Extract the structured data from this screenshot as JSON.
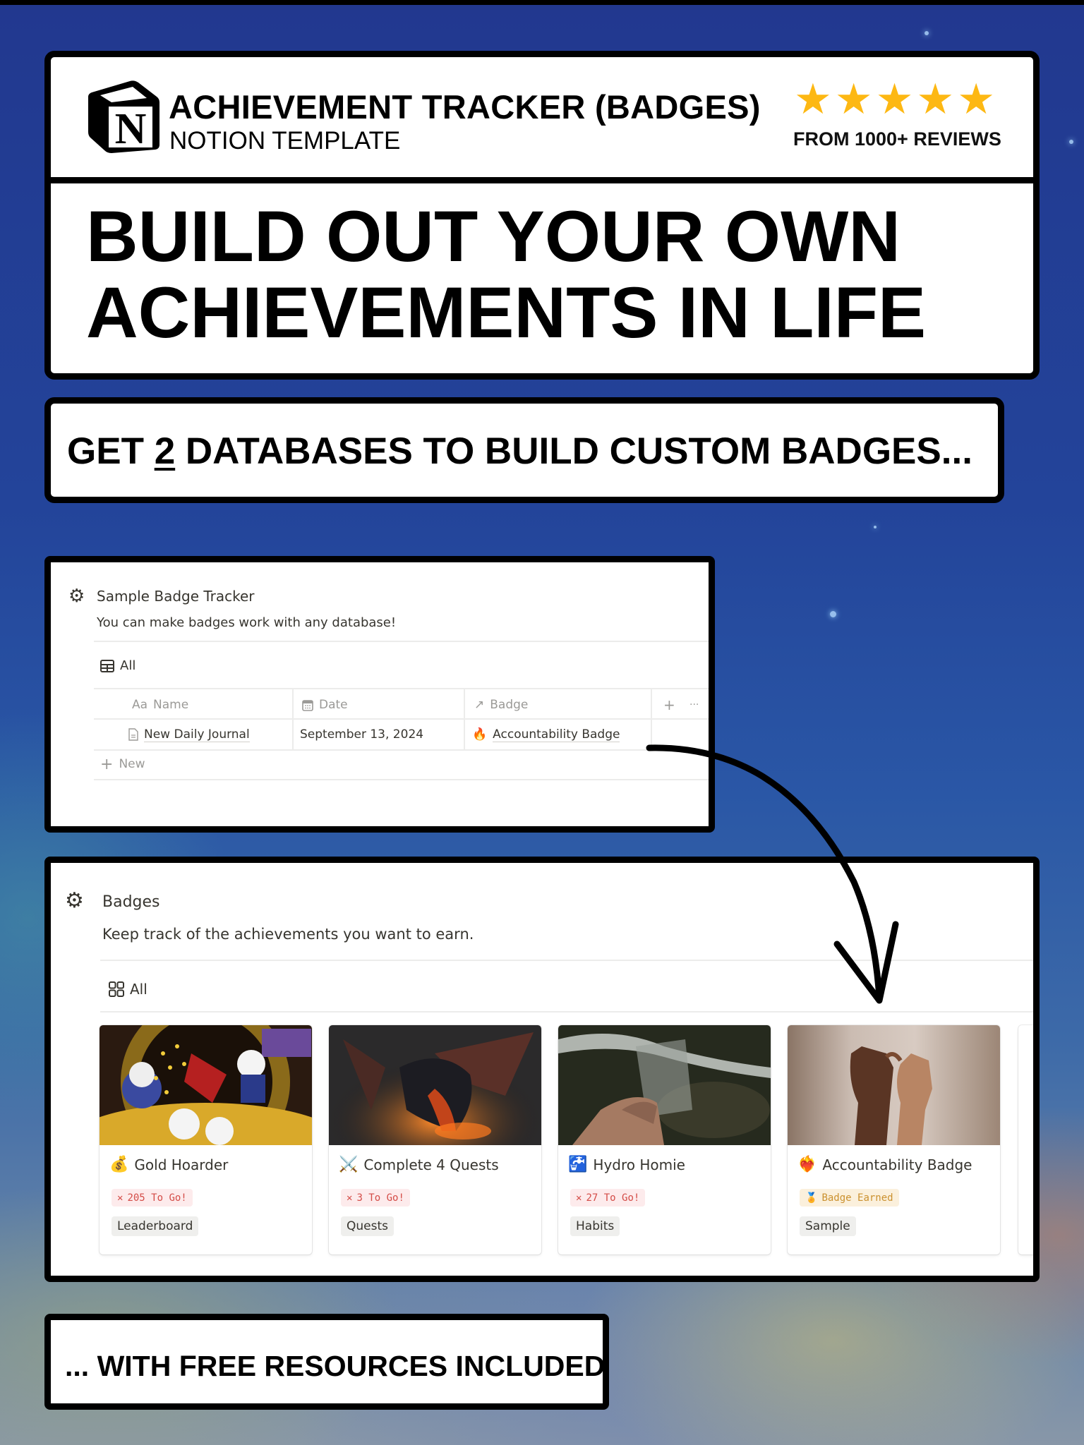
{
  "header": {
    "title": "ACHIEVEMENT TRACKER (BADGES)",
    "subtitle": "NOTION TEMPLATE",
    "logo_icon": "notion-logo-icon",
    "rating": {
      "stars": 5,
      "max": 5,
      "star_color": "#fdb813",
      "reviews_label": "FROM 1000+ REVIEWS"
    },
    "headline_line1": "BUILD OUT YOUR OWN",
    "headline_line2": "ACHIEVEMENTS IN LIFE"
  },
  "subheading": {
    "before": "GET ",
    "number": "2",
    "after": " DATABASES TO BUILD CUSTOM BADGES..."
  },
  "tracker": {
    "icon": "gear-icon",
    "title": "Sample Badge Tracker",
    "description": "You can make badges work with any database!",
    "view_label": "All",
    "columns": [
      {
        "icon": "Aa",
        "label": "Name"
      },
      {
        "icon": "calendar-icon",
        "label": "Date"
      },
      {
        "icon": "↗",
        "label": "Badge"
      }
    ],
    "add_column": "+",
    "more": "···",
    "rows": [
      {
        "name": "New Daily Journal",
        "date": "September 13, 2024",
        "badge_icon": "🔥",
        "badge": "Accountability Badge"
      }
    ],
    "new_label": "New"
  },
  "badges": {
    "icon": "gear-icon",
    "title": "Badges",
    "description": "Keep track of the achievements you want to earn.",
    "view_label": "All",
    "cards": [
      {
        "icon": "💰",
        "title": "Gold Hoarder",
        "status": "205 To Go!",
        "status_type": "red",
        "status_icon": "✕",
        "tag": "Leaderboard",
        "cover": "cartoon-gold-vault"
      },
      {
        "icon": "⚔️",
        "title": "Complete 4 Quests",
        "status": "3 To Go!",
        "status_type": "red",
        "status_icon": "✕",
        "tag": "Quests",
        "cover": "dragon"
      },
      {
        "icon": "🚰",
        "title": "Hydro Homie",
        "status": "27 To Go!",
        "status_type": "red",
        "status_icon": "✕",
        "tag": "Habits",
        "cover": "water-glass"
      },
      {
        "icon": "❤️‍🔥",
        "title": "Accountability Badge",
        "status": "Badge Earned",
        "status_type": "gold",
        "status_icon": "🏅",
        "tag": "Sample",
        "cover": "pinky-promise"
      }
    ]
  },
  "footer": {
    "label": "... WITH FREE RESOURCES INCLUDED"
  }
}
